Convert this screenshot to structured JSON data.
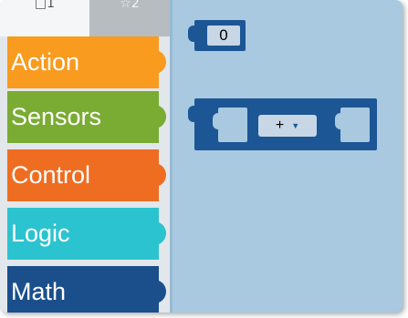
{
  "toolbox": {
    "tabs": [
      {
        "label": "□1"
      },
      {
        "label": "☆2"
      }
    ],
    "categories": [
      {
        "label": "Action",
        "color": "#f89b1e"
      },
      {
        "label": "Sensors",
        "color": "#7aab33"
      },
      {
        "label": "Control",
        "color": "#ef6d21"
      },
      {
        "label": "Logic",
        "color": "#2cc3d0"
      },
      {
        "label": "Math",
        "color": "#1a4f8c"
      }
    ]
  },
  "workspace": {
    "background": "#a8c9e0",
    "number_block": {
      "value": "0",
      "color": "#1c5695"
    },
    "arithmetic_block": {
      "operator": "+",
      "dropdown_icon": "triangle-down-icon",
      "color": "#1c5695"
    }
  }
}
